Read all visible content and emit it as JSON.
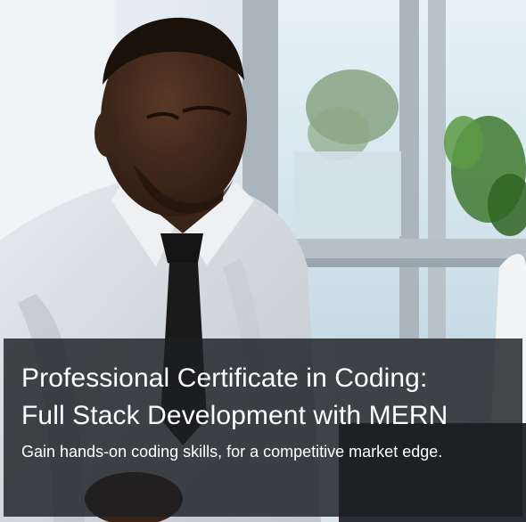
{
  "hero": {
    "image_alt": "Man in a white shirt and black tie working at a laptop by a window",
    "title_line1": "Professional Certificate in Coding:",
    "title_line2": "Full Stack Development with MERN",
    "subtitle": "Gain hands-on coding skills, for a competitive market edge."
  },
  "colors": {
    "overlay": "#1c1e22",
    "text": "#ffffff",
    "window_sky": "#dfeef5",
    "shirt": "#d9dde2",
    "skin": "#3a2418",
    "tie": "#141414",
    "plant": "#3f7a2f"
  }
}
